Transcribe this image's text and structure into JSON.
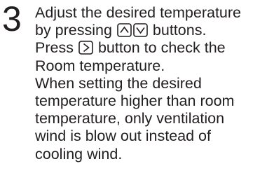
{
  "step": {
    "number": "3",
    "line1": "Adjust the desired temperature",
    "line2_before": "by pressing",
    "line2_after": "buttons.",
    "line3_before": "Press",
    "line3_after": "button to check the",
    "line4": "Room temperature.",
    "line5": "When setting the desired",
    "line6": "temperature higher than room",
    "line7": "temperature, only ventilation",
    "line8": "wind is blow out instead of",
    "line9": "cooling wind."
  },
  "icons": {
    "up": "up-arrow-button-icon",
    "down": "down-arrow-button-icon",
    "right": "right-arrow-button-icon"
  }
}
